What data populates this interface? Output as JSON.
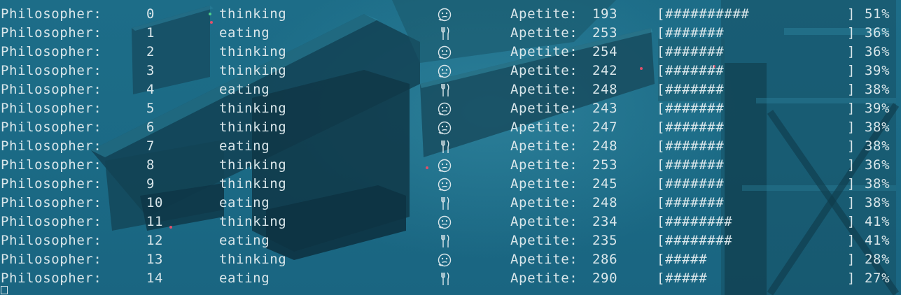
{
  "terminal": {
    "rows": [
      {
        "label": "Philosopher:",
        "id": "0",
        "state": "thinking",
        "icon": "thinking-face-icon",
        "apetite_label": "Apetite:",
        "apetite": "193",
        "bar": "[##########",
        "bar_close": "]",
        "percent": "51%"
      },
      {
        "label": "Philosopher:",
        "id": "1",
        "state": "eating",
        "icon": "fork-knife-icon",
        "apetite_label": "Apetite:",
        "apetite": "253",
        "bar": "[#######",
        "bar_close": "]",
        "percent": "36%"
      },
      {
        "label": "Philosopher:",
        "id": "2",
        "state": "thinking",
        "icon": "thinking-face-icon",
        "apetite_label": "Apetite:",
        "apetite": "254",
        "bar": "[#######",
        "bar_close": "]",
        "percent": "36%"
      },
      {
        "label": "Philosopher:",
        "id": "3",
        "state": "thinking",
        "icon": "thinking-face-icon",
        "apetite_label": "Apetite:",
        "apetite": "242",
        "bar": "[#######",
        "bar_close": "]",
        "percent": "39%"
      },
      {
        "label": "Philosopher:",
        "id": "4",
        "state": "eating",
        "icon": "fork-knife-icon",
        "apetite_label": "Apetite:",
        "apetite": "248",
        "bar": "[#######",
        "bar_close": "]",
        "percent": "38%"
      },
      {
        "label": "Philosopher:",
        "id": "5",
        "state": "thinking",
        "icon": "thinking-face-icon",
        "apetite_label": "Apetite:",
        "apetite": "243",
        "bar": "[#######",
        "bar_close": "]",
        "percent": "39%"
      },
      {
        "label": "Philosopher:",
        "id": "6",
        "state": "thinking",
        "icon": "thinking-face-icon",
        "apetite_label": "Apetite:",
        "apetite": "247",
        "bar": "[#######",
        "bar_close": "]",
        "percent": "38%"
      },
      {
        "label": "Philosopher:",
        "id": "7",
        "state": "eating",
        "icon": "fork-knife-icon",
        "apetite_label": "Apetite:",
        "apetite": "248",
        "bar": "[#######",
        "bar_close": "]",
        "percent": "38%"
      },
      {
        "label": "Philosopher:",
        "id": "8",
        "state": "thinking",
        "icon": "thinking-face-icon",
        "apetite_label": "Apetite:",
        "apetite": "253",
        "bar": "[#######",
        "bar_close": "]",
        "percent": "36%"
      },
      {
        "label": "Philosopher:",
        "id": "9",
        "state": "thinking",
        "icon": "thinking-face-icon",
        "apetite_label": "Apetite:",
        "apetite": "245",
        "bar": "[#######",
        "bar_close": "]",
        "percent": "38%"
      },
      {
        "label": "Philosopher:",
        "id": "10",
        "state": "eating",
        "icon": "fork-knife-icon",
        "apetite_label": "Apetite:",
        "apetite": "248",
        "bar": "[#######",
        "bar_close": "]",
        "percent": "38%"
      },
      {
        "label": "Philosopher:",
        "id": "11",
        "state": "thinking",
        "icon": "thinking-face-icon",
        "apetite_label": "Apetite:",
        "apetite": "234",
        "bar": "[########",
        "bar_close": "]",
        "percent": "41%"
      },
      {
        "label": "Philosopher:",
        "id": "12",
        "state": "eating",
        "icon": "fork-knife-icon",
        "apetite_label": "Apetite:",
        "apetite": "235",
        "bar": "[########",
        "bar_close": "]",
        "percent": "41%"
      },
      {
        "label": "Philosopher:",
        "id": "13",
        "state": "thinking",
        "icon": "thinking-face-icon",
        "apetite_label": "Apetite:",
        "apetite": "286",
        "bar": "[#####",
        "bar_close": "]",
        "percent": "28%"
      },
      {
        "label": "Philosopher:",
        "id": "14",
        "state": "eating",
        "icon": "fork-knife-icon",
        "apetite_label": "Apetite:",
        "apetite": "290",
        "bar": "[#####",
        "bar_close": "]",
        "percent": "27%"
      }
    ],
    "cursor_icon": "block-cursor-icon"
  },
  "colors": {
    "text": "#d9e6ea",
    "background": "#1f6b86",
    "accent_green": "#4fd08a",
    "accent_red": "#e0506a"
  }
}
